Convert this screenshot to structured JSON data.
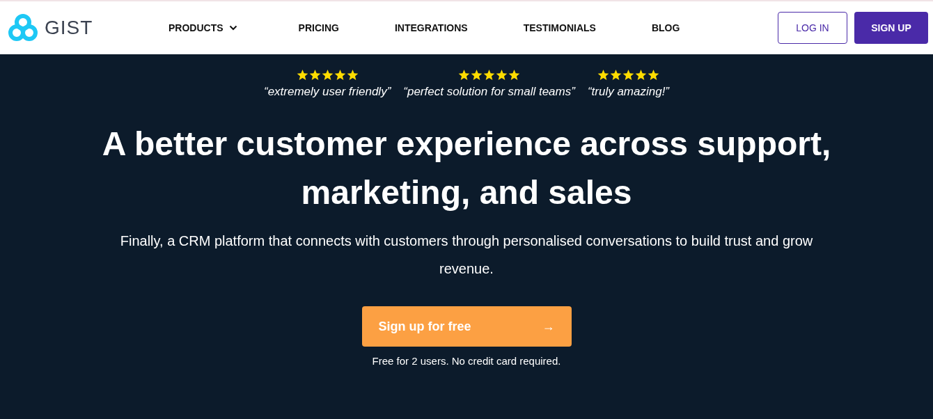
{
  "logo": {
    "text": "GIST"
  },
  "nav": [
    {
      "label": "PRODUCTS",
      "dropdown": true
    },
    {
      "label": "PRICING",
      "dropdown": false
    },
    {
      "label": "INTEGRATIONS",
      "dropdown": false
    },
    {
      "label": "TESTIMONIALS",
      "dropdown": false
    },
    {
      "label": "BLOG",
      "dropdown": false
    }
  ],
  "auth_buttons": [
    {
      "label": "LOG IN",
      "kind": "outline"
    },
    {
      "label": "SIGN UP",
      "kind": "solid"
    }
  ],
  "reviews": [
    {
      "stars": 5,
      "quote": "“extremely user friendly”"
    },
    {
      "stars": 5,
      "quote": "“perfect solution for small teams”"
    },
    {
      "stars": 5,
      "quote": "“truly amazing!”"
    }
  ],
  "headline": "A better customer experience across support, marketing, and sales",
  "subtitle": "Finally, a CRM platform that connects with customers through personalised conversations to build trust and grow revenue.",
  "cta": {
    "label": "Sign up for free",
    "arrow": "→"
  },
  "note": "Free for 2 users. No credit card required."
}
